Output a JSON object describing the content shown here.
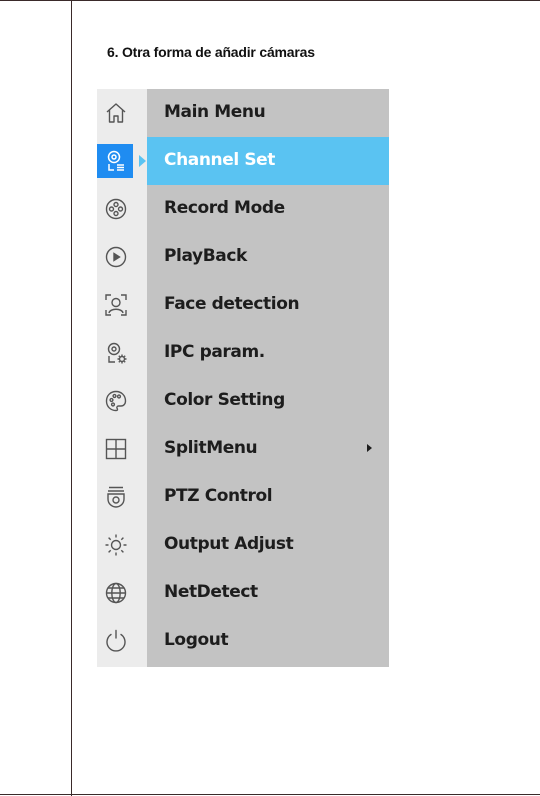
{
  "section": {
    "title": "6. Otra forma de añadir cámaras"
  },
  "menu": {
    "items": [
      {
        "label": "Main Menu",
        "icon": "home-icon"
      },
      {
        "label": "Channel Set",
        "icon": "channel-set-icon",
        "selected": true
      },
      {
        "label": "Record Mode",
        "icon": "record-reel-icon"
      },
      {
        "label": "PlayBack",
        "icon": "playback-icon"
      },
      {
        "label": "Face detection",
        "icon": "face-detection-icon"
      },
      {
        "label": "IPC param.",
        "icon": "ipc-param-icon"
      },
      {
        "label": "Color Setting",
        "icon": "palette-icon"
      },
      {
        "label": "SplitMenu",
        "icon": "split-grid-icon",
        "has_submenu": true
      },
      {
        "label": "PTZ Control",
        "icon": "ptz-camera-icon"
      },
      {
        "label": "Output Adjust",
        "icon": "brightness-icon"
      },
      {
        "label": "NetDetect",
        "icon": "globe-icon"
      },
      {
        "label": "Logout",
        "icon": "power-icon"
      }
    ],
    "colors": {
      "selected_label_bg": "#5ac3f2",
      "selected_icon_bg": "#1f8cf1",
      "label_column_bg": "#c3c3c3",
      "icon_column_bg": "#ececec"
    }
  }
}
